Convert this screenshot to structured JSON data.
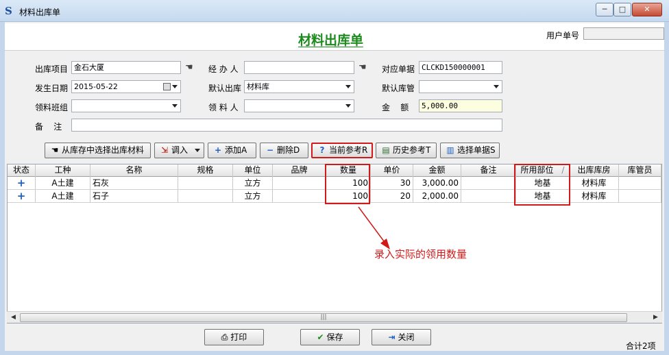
{
  "window": {
    "title": "材料出库单",
    "min_glyph": "─",
    "max_glyph": "□",
    "close_glyph": "✕"
  },
  "header": {
    "title": "材料出库单",
    "user_no_label": "用户单号",
    "user_no_value": ""
  },
  "form": {
    "project_label": "出库项目",
    "project_value": "金石大厦",
    "handler_label": "经 办 人",
    "handler_value": "",
    "ref_label": "对应单据",
    "ref_value": "CLCKD150000001",
    "date_label": "发生日期",
    "date_value": "2015-05-22",
    "warehouse_label": "默认出库",
    "warehouse_value": "材料库",
    "keeper_label": "默认库管",
    "keeper_value": "",
    "team_label": "领料班组",
    "team_value": "",
    "receiver_label": "领 料 人",
    "receiver_value": "",
    "amount_label": "金    额",
    "amount_value": "5,000.00",
    "note_label": "备    注",
    "note_value": ""
  },
  "toolbar": {
    "select_stock": "从库存中选择出库材料",
    "transfer_in": "调入",
    "add": "添加A",
    "delete": "删除D",
    "current_ref": "当前参考R",
    "history_ref": "历史参考T",
    "select_doc": "选择单据S"
  },
  "grid": {
    "columns": [
      "状态",
      "工种",
      "名称",
      "规格",
      "单位",
      "品牌",
      "数量",
      "单价",
      "金额",
      "备注",
      "所用部位",
      "出库库房",
      "库管员"
    ],
    "sort_glyph": "/",
    "rows": [
      {
        "status": "+",
        "trade": "A土建",
        "name": "石灰",
        "spec": "",
        "unit": "立方",
        "brand": "",
        "qty": "100",
        "price": "30",
        "amount": "3,000.00",
        "note": "",
        "part": "地基",
        "warehouse": "材料库",
        "keeper": ""
      },
      {
        "status": "+",
        "trade": "A土建",
        "name": "石子",
        "spec": "",
        "unit": "立方",
        "brand": "",
        "qty": "100",
        "price": "20",
        "amount": "2,000.00",
        "note": "",
        "part": "地基",
        "warehouse": "材料库",
        "keeper": ""
      }
    ]
  },
  "annotation": {
    "text": "录入实际的领用数量",
    "color": "#d01a1a"
  },
  "bottom": {
    "print": "打印",
    "save": "保存",
    "close": "关闭",
    "total": "合计2项"
  },
  "colors": {
    "title_green": "#1c8a1c",
    "highlight_red": "#d01a1a",
    "amount_bg": "#fdfde0"
  }
}
